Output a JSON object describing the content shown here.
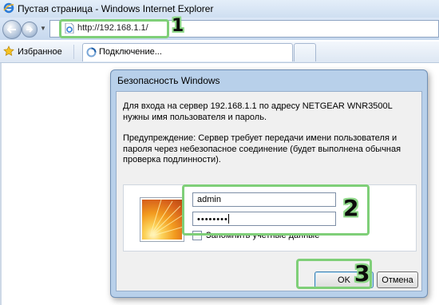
{
  "browser": {
    "window_title": "Пустая страница - Windows Internet Explorer",
    "address_url": "http://192.168.1.1/",
    "favorites_label": "Избранное",
    "tab_label": "Подключение..."
  },
  "dialog": {
    "title": "Безопасность Windows",
    "message": "Для входа на сервер 192.168.1.1 по адресу NETGEAR WNR3500L нужны имя пользователя и пароль.",
    "warning": "Предупреждение: Сервер требует передачи имени пользователя и пароля через небезопасное соединение (будет выполнена обычная проверка подлинности).",
    "username_value": "admin",
    "password_masked": "••••••••",
    "remember_label": "Запомнить учетные данные",
    "remember_checked": false,
    "ok_label": "OK",
    "cancel_label": "Отмена"
  },
  "callouts": {
    "step1": "1",
    "step2": "2",
    "step3": "3",
    "color": "#7fcf78"
  }
}
